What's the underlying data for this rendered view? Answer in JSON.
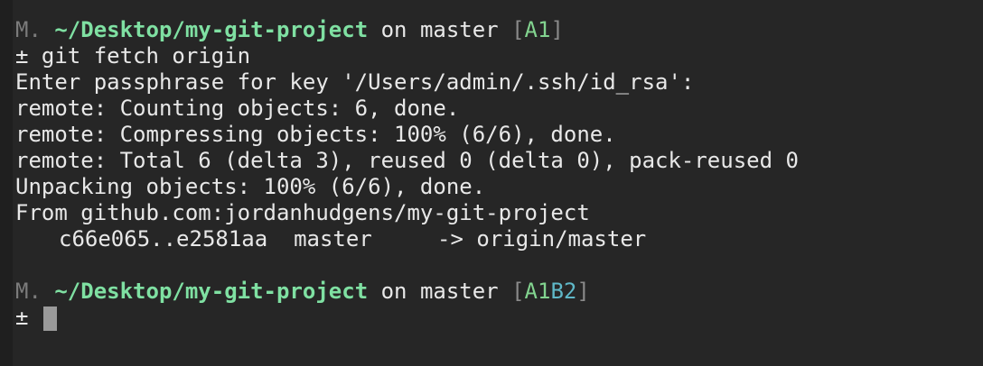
{
  "prompt1": {
    "status": "M.",
    "path": "~/Desktop/my-git-project",
    "branch_text": " on master ",
    "lbracket": "[",
    "a_part": "A1",
    "b_part": "",
    "rbracket": "]"
  },
  "command": {
    "symbol": "±",
    "text": " git fetch origin"
  },
  "output": [
    "Enter passphrase for key '/Users/admin/.ssh/id_rsa':",
    "remote: Counting objects: 6, done.",
    "remote: Compressing objects: 100% (6/6), done.",
    "remote: Total 6 (delta 3), reused 0 (delta 0), pack-reused 0",
    "Unpacking objects: 100% (6/6), done.",
    "From github.com:jordanhudgens/my-git-project"
  ],
  "ref_update": "c66e065..e2581aa  master     -> origin/master",
  "prompt2": {
    "status": "M.",
    "path": "~/Desktop/my-git-project",
    "branch_text": " on master ",
    "lbracket": "[",
    "a_part": "A1",
    "b_part": "B2",
    "rbracket": "]"
  },
  "input_line": {
    "symbol": "± "
  }
}
